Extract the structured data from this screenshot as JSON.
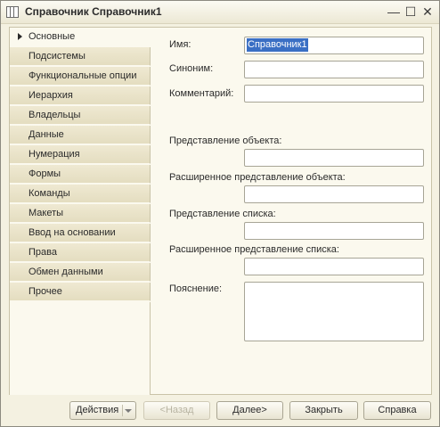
{
  "window": {
    "title": "Справочник Справочник1",
    "controls": {
      "minimize": "—",
      "maximize": "☐",
      "close": "✕"
    }
  },
  "nav": {
    "items": [
      {
        "label": "Основные",
        "active": true
      },
      {
        "label": "Подсистемы"
      },
      {
        "label": "Функциональные опции"
      },
      {
        "label": "Иерархия"
      },
      {
        "label": "Владельцы"
      },
      {
        "label": "Данные"
      },
      {
        "label": "Нумерация"
      },
      {
        "label": "Формы"
      },
      {
        "label": "Команды"
      },
      {
        "label": "Макеты"
      },
      {
        "label": "Ввод на основании"
      },
      {
        "label": "Права"
      },
      {
        "label": "Обмен данными"
      },
      {
        "label": "Прочее"
      }
    ]
  },
  "form": {
    "name_label": "Имя:",
    "name_value": "Справочник1",
    "synonym_label": "Синоним:",
    "synonym_value": "",
    "comment_label": "Комментарий:",
    "comment_value": "",
    "object_presentation_label": "Представление объекта:",
    "object_presentation_value": "",
    "extended_object_presentation_label": "Расширенное представление объекта:",
    "extended_object_presentation_value": "",
    "list_presentation_label": "Представление списка:",
    "list_presentation_value": "",
    "extended_list_presentation_label": "Расширенное представление списка:",
    "extended_list_presentation_value": "",
    "explanation_label": "Пояснение:",
    "explanation_value": ""
  },
  "footer": {
    "actions_label": "Действия",
    "back_label": "<Назад",
    "next_label": "Далее>",
    "close_label": "Закрыть",
    "help_label": "Справка"
  },
  "colors": {
    "window_bg": "#f4f1e1",
    "nav_bg": "#e8e2c8",
    "selection": "#3a6fc4"
  }
}
